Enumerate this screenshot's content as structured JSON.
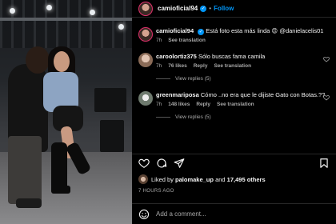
{
  "post": {
    "username": "camioficial94",
    "follow_label": "Follow",
    "separator": "•"
  },
  "caption": {
    "username": "camioficial94",
    "text": "Está foto esta más linda 😍 @danielacelis01",
    "time": "7h",
    "see_translation": "See translation"
  },
  "comments": [
    {
      "username": "caroolortiz375",
      "text": "Sólo buscas fama camila",
      "time": "7h",
      "likes": "76 likes",
      "reply": "Reply",
      "see_translation": "See translation",
      "view_replies": "View replies (5)"
    },
    {
      "username": "greenmariposa",
      "text": "Cómo ..no era que le dijiste Gato con Botas.??",
      "time": "7h",
      "likes": "148 likes",
      "reply": "Reply",
      "see_translation": "See translation",
      "view_replies": "View replies (5)"
    }
  ],
  "likes": {
    "prefix": "Liked by",
    "user": "palomake_up",
    "middle": "and",
    "others": "17,495 others"
  },
  "timestamp": "7 HOURS AGO",
  "add_comment": {
    "placeholder": "Add a comment..."
  },
  "colors": {
    "accent": "#0095f6",
    "muted": "#a8a8a8",
    "background": "#000000"
  }
}
